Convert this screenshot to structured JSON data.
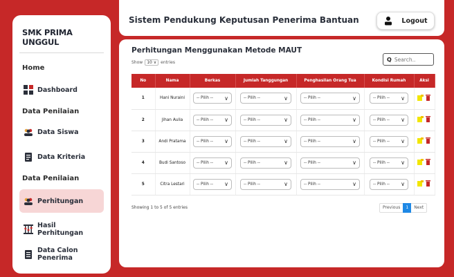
{
  "sidebar": {
    "brand": "SMK PRIMA UNGGUL",
    "sections": {
      "home": "Home",
      "penilaian_1": "Data Penilaian",
      "penilaian_2": "Data Penilaian"
    },
    "items": {
      "dashboard": "Dashboard",
      "data_siswa": "Data Siswa",
      "data_kriteria": "Data Kriteria",
      "perhitungan": "Perhitungan",
      "hasil_perhitungan": "Hasil Perhitungan",
      "data_calon": "Data Calon Penerima"
    }
  },
  "header": {
    "title": "Sistem Pendukung Keputusan Penerima Bantuan",
    "logout_label": "Logout"
  },
  "main": {
    "title": "Perhitungan Menggunakan Metode MAUT",
    "show_label": "Show",
    "show_value": "10",
    "entries_label": "entries",
    "search_placeholder": "Search..",
    "columns": [
      "No",
      "Nama",
      "Berkas",
      "Jumlah Tanggungan",
      "Penghasilan Orang Tua",
      "Kondisi Rumah",
      "Aksi"
    ],
    "rows": [
      {
        "no": "1",
        "nama": "Hani Nuraini"
      },
      {
        "no": "2",
        "nama": "Jihan Aulia"
      },
      {
        "no": "3",
        "nama": "Andi Pratama"
      },
      {
        "no": "4",
        "nama": "Budi Santoso"
      },
      {
        "no": "5",
        "nama": "Citra Lestari"
      }
    ],
    "dropdown_value": "-- Pilih --",
    "footer_info": "Showing 1 to 5 of 5 entries",
    "pagination": {
      "prev": "Previous",
      "current": "1",
      "next": "Next"
    }
  },
  "colors": {
    "accent": "#c62828",
    "active_bg": "#f7d6d6",
    "edit_icon": "#f2e600",
    "delete_icon": "#c62828",
    "page_active": "#1e88e5"
  }
}
